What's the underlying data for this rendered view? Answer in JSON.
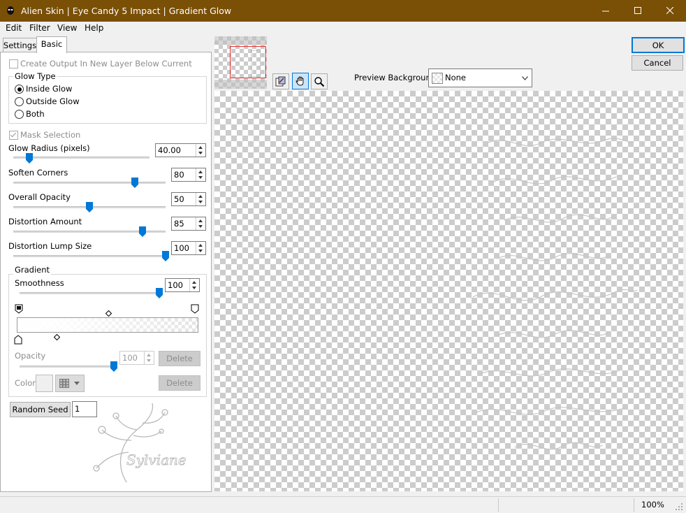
{
  "window": {
    "title": "Alien Skin | Eye Candy 5 Impact | Gradient Glow",
    "titlebar_color": "#7a4f06"
  },
  "menu": {
    "items": [
      "Edit",
      "Filter",
      "View",
      "Help"
    ]
  },
  "tabs": [
    "Settings",
    "Basic"
  ],
  "active_tab": "Basic",
  "basic": {
    "create_output_label": "Create Output In New Layer Below Current",
    "create_output_checked": false,
    "glow_type": {
      "title": "Glow Type",
      "options": [
        "Inside Glow",
        "Outside Glow",
        "Both"
      ],
      "selected": "Inside Glow"
    },
    "mask_selection_label": "Mask Selection",
    "mask_selection_checked": true,
    "sliders": [
      {
        "label": "Glow Radius (pixels)",
        "value": "40.00",
        "fraction": 0.12
      },
      {
        "label": "Soften Corners",
        "value": "80",
        "fraction": 0.8
      },
      {
        "label": "Overall Opacity",
        "value": "50",
        "fraction": 0.5
      },
      {
        "label": "Distortion Amount",
        "value": "85",
        "fraction": 0.85
      },
      {
        "label": "Distortion Lump Size",
        "value": "100",
        "fraction": 1.0
      }
    ],
    "gradient": {
      "title": "Gradient",
      "smoothness_label": "Smoothness",
      "smoothness_value": "100",
      "smoothness_fraction": 1.0,
      "opacity_label": "Opacity",
      "opacity_value": "100",
      "opacity_fraction": 1.0,
      "delete_label": "Delete",
      "color_label": "Color"
    },
    "random_seed_label": "Random Seed",
    "random_seed_value": "1",
    "watermark": "Sylviane"
  },
  "preview": {
    "background_label": "Preview Background:",
    "background_value": "None",
    "tools": [
      "zoom-to-fit-icon",
      "hand-pan-icon",
      "magnifier-icon"
    ]
  },
  "buttons": {
    "ok": "OK",
    "cancel": "Cancel"
  },
  "status": {
    "zoom": "100%"
  },
  "accent": "#0078d7"
}
